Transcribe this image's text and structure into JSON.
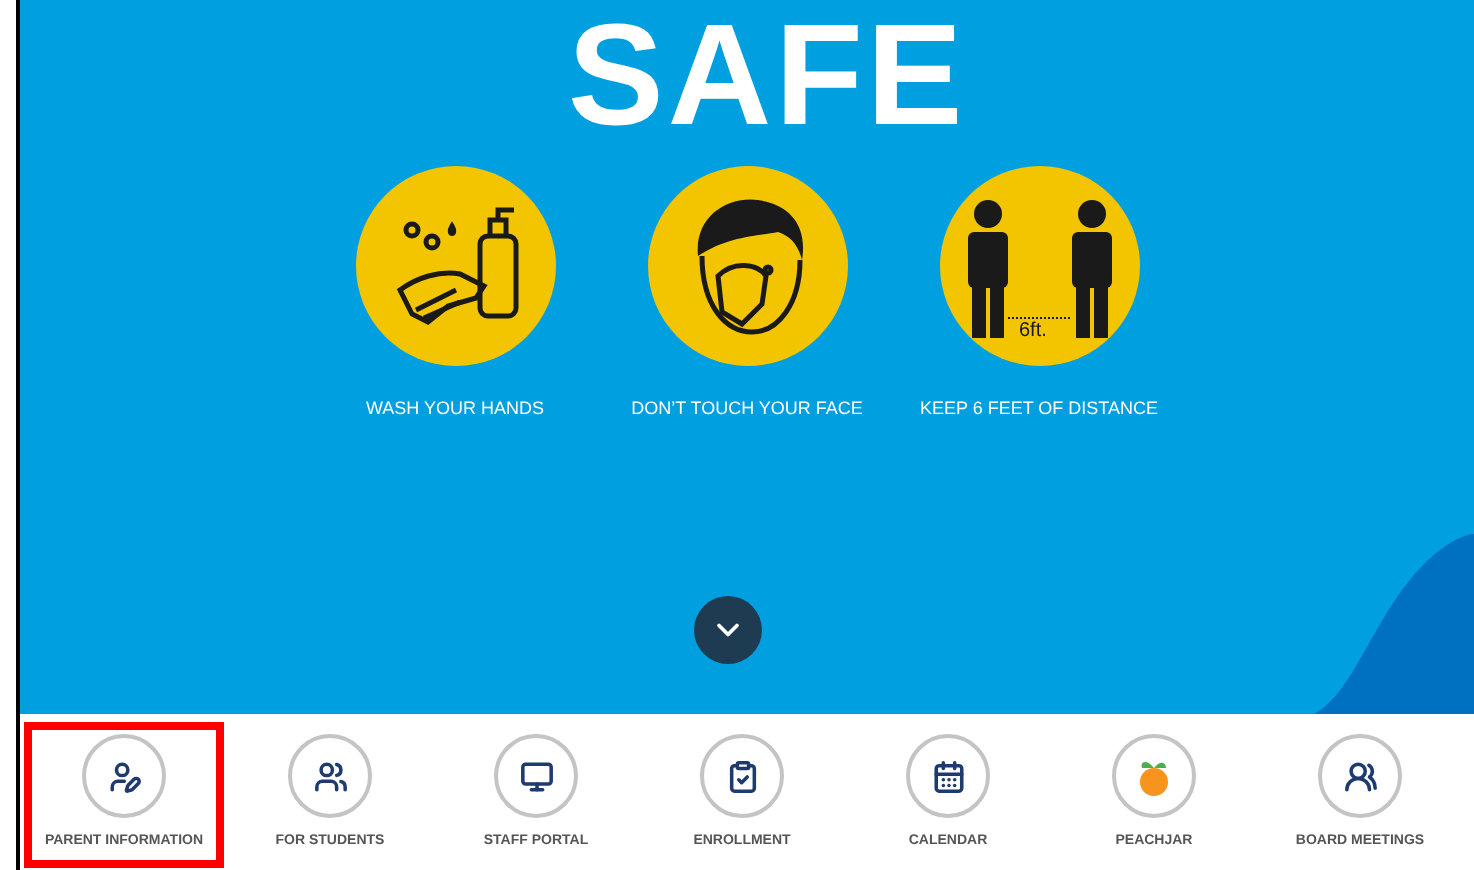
{
  "hero": {
    "title": "SAFE",
    "tips": [
      {
        "kind": "hands",
        "label": "WASH YOUR HANDS"
      },
      {
        "kind": "face",
        "label": "DON’T TOUCH YOUR FACE"
      },
      {
        "kind": "distance",
        "label": "KEEP 6 FEET OF DISTANCE",
        "distance": "6ft."
      }
    ]
  },
  "quick_links": [
    {
      "kind": "parent",
      "label": "PARENT INFORMATION",
      "highlighted": true
    },
    {
      "kind": "students",
      "label": "FOR STUDENTS",
      "highlighted": false
    },
    {
      "kind": "staff",
      "label": "STAFF PORTAL",
      "highlighted": false
    },
    {
      "kind": "enroll",
      "label": "ENROLLMENT",
      "highlighted": false
    },
    {
      "kind": "calendar",
      "label": "CALENDAR",
      "highlighted": false
    },
    {
      "kind": "peach",
      "label": "PEACHJAR",
      "highlighted": false
    },
    {
      "kind": "board",
      "label": "BOARD MEETINGS",
      "highlighted": false
    }
  ]
}
